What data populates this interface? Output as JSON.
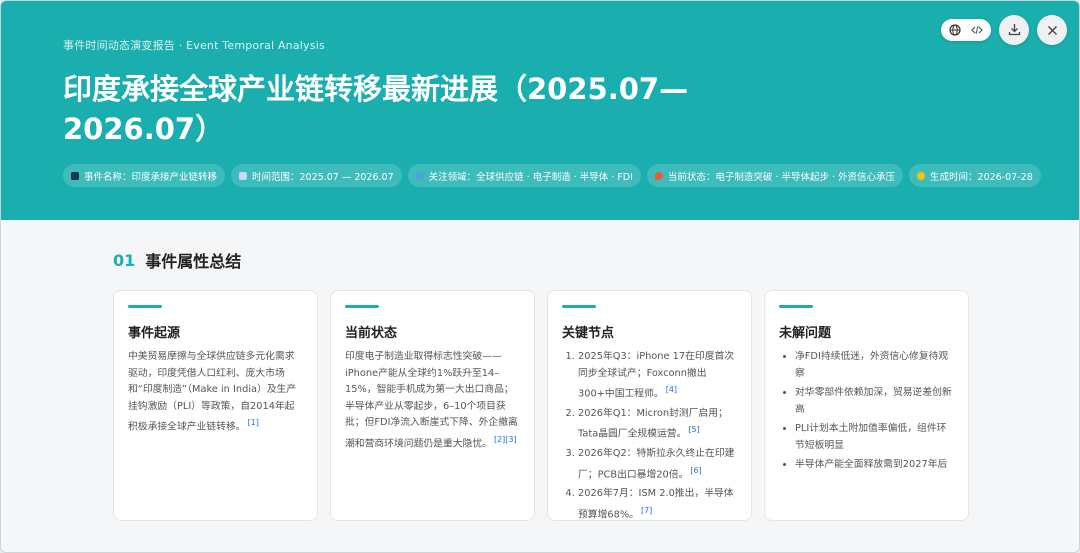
{
  "header": {
    "eyebrow": "事件时间动态演变报告 · Event Temporal Analysis",
    "title": "印度承接全球产业链转移最新进展（2025.07—2026.07）",
    "tags": [
      {
        "label": "事件名称：印度承接产业链转移",
        "icon": "flag-icon",
        "color": "#1d3557"
      },
      {
        "label": "时间范围：2025.07 — 2026.07",
        "icon": "calendar-icon",
        "color": "#c9d6ff"
      },
      {
        "label": "关注领域：全球供应链 · 电子制造 · 半导体 · FDI",
        "icon": "globe-icon",
        "color": "#4ea3d8"
      },
      {
        "label": "当前状态：电子制造突破 · 半导体起步 · 外资信心承压",
        "icon": "pin-icon",
        "color": "#e85d3a"
      },
      {
        "label": "生成时间：2026-07-28",
        "icon": "clock-icon",
        "color": "#f1c40f"
      }
    ]
  },
  "section": {
    "num": "01",
    "title": "事件属性总结"
  },
  "cards": [
    {
      "title": "事件起源",
      "text": "中美贸易摩擦与全球供应链多元化需求驱动，印度凭借人口红利、庞大市场和“印度制造”（Make in India）及生产挂钩激励（PLI）等政策，自2014年起积极承接全球产业链转移。",
      "refs": "[1]"
    },
    {
      "title": "当前状态",
      "text": "印度电子制造业取得标志性突破——iPhone产能从全球约1%跃升至14–15%，智能手机成为第一大出口商品；半导体产业从零起步，6–10个项目获批；但FDI净流入断崖式下降、外企撤离潮和营商环境问题仍是重大隐忧。",
      "refs": "[2][3]"
    },
    {
      "title": "关键节点",
      "items": [
        {
          "text": "2025年Q3：iPhone 17在印度首次同步全球试产；Foxconn撤出300+中国工程师。",
          "ref": "[4]"
        },
        {
          "text": "2026年Q1：Micron封测厂启用；Tata晶圆厂全规模运营。",
          "ref": "[5]"
        },
        {
          "text": "2026年Q2：特斯拉永久终止在印建厂；PCB出口暴增20倍。",
          "ref": "[6]"
        },
        {
          "text": "2026年7月：ISM 2.0推出，半导体预算增68%。",
          "ref": "[7]"
        }
      ]
    },
    {
      "title": "未解问题",
      "items": [
        {
          "text": "净FDI持续低迷，外资信心修复待观察"
        },
        {
          "text": "对华零部件依赖加深，贸易逆差创新高"
        },
        {
          "text": "PLI计划本土附加值率偏低，组件环节短板明显"
        },
        {
          "text": "半导体产能全面释放需到2027年后"
        }
      ]
    }
  ]
}
